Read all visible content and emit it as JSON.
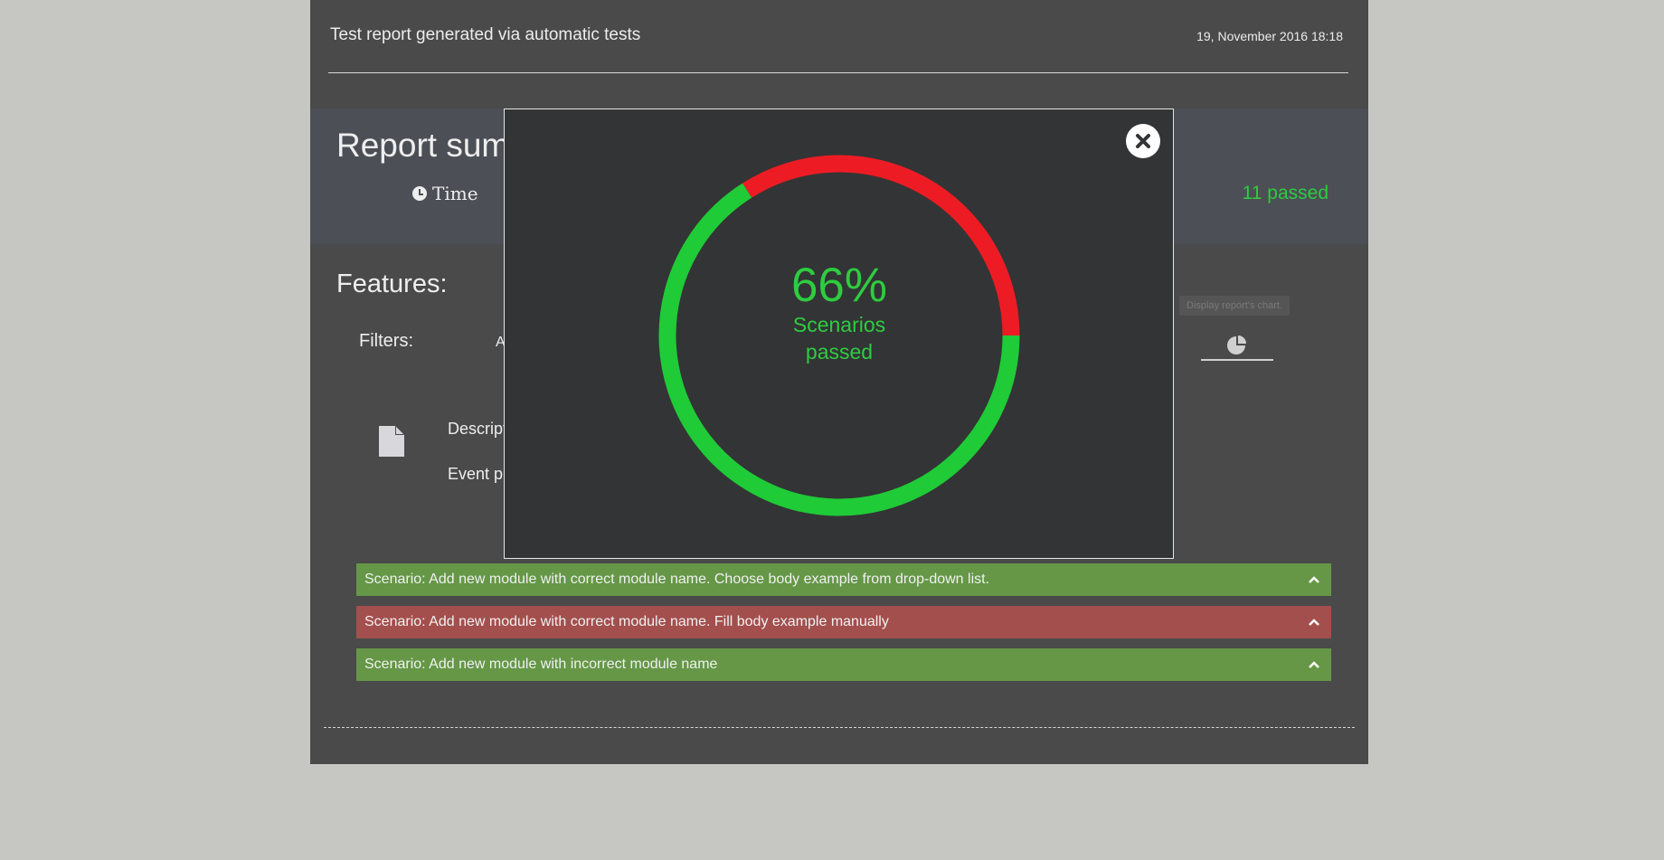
{
  "header": {
    "title": "Test report generated via automatic tests",
    "date": "19, November 2016 18:18"
  },
  "summary": {
    "title": "Report sum",
    "time_label": "Time",
    "passed_text": "11 passed",
    "passed_color": "#2ecc40"
  },
  "features": {
    "title": "Features:",
    "filters_label": "Filters:",
    "filters_value": "A",
    "chart_button_tooltip": "Display report's chart.",
    "chart_button_icon": "pie-chart-icon"
  },
  "feature_info": {
    "description_label": "Descripti",
    "event_label": "Event pr",
    "icon": "document-icon"
  },
  "scenarios": [
    {
      "title": "Scenario: Add new module with correct module name. Choose body example from drop-down list.",
      "status": "passed",
      "color": "#659747"
    },
    {
      "title": "Scenario: Add new module with correct module name. Fill body example manually",
      "status": "failed",
      "color": "#a34f4d"
    },
    {
      "title": "Scenario: Add new module with incorrect module name",
      "status": "passed",
      "color": "#659747"
    }
  ],
  "modal": {
    "close_icon": "close-icon",
    "percent_text": "66%",
    "caption": "Scenarios passed",
    "passed_fraction": 0.66,
    "passed_color": "#1fcb37",
    "failed_color": "#ed1c24"
  }
}
